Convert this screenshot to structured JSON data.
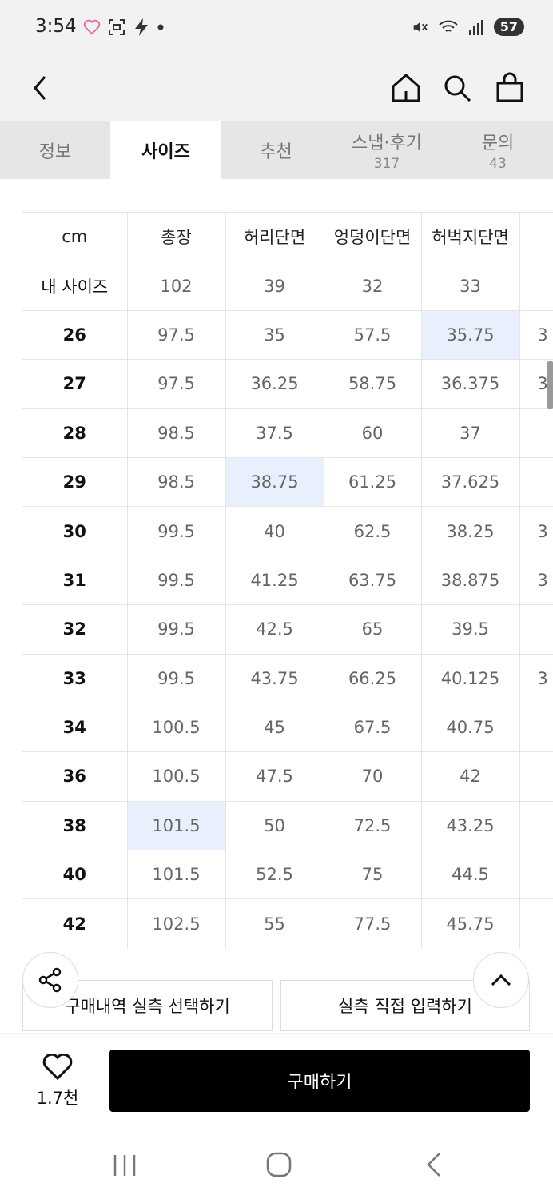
{
  "status": {
    "time": "3:54",
    "battery": "57",
    "left_icons": [
      "heart-icon",
      "screen-capture-icon",
      "charging-bolt-icon",
      "dot-icon"
    ],
    "right_icons": [
      "mute-icon",
      "wifi-icon",
      "signal-icon",
      "battery-icon"
    ]
  },
  "nav": {
    "icons": [
      "back-icon",
      "home-icon",
      "search-icon",
      "shopping-bag-icon"
    ]
  },
  "tabs": [
    {
      "label": "정보",
      "count": "",
      "active": false
    },
    {
      "label": "사이즈",
      "count": "",
      "active": true
    },
    {
      "label": "추천",
      "count": "",
      "active": false
    },
    {
      "label": "스냅·후기",
      "count": "317",
      "active": false
    },
    {
      "label": "문의",
      "count": "43",
      "active": false
    }
  ],
  "size_table": {
    "headers": [
      "cm",
      "총장",
      "허리단면",
      "엉덩이단면",
      "허벅지단면"
    ],
    "my_size": [
      "내 사이즈",
      "102",
      "39",
      "32",
      "33"
    ],
    "rows": [
      [
        "26",
        "97.5",
        "35",
        "57.5",
        "35.75",
        "3"
      ],
      [
        "27",
        "97.5",
        "36.25",
        "58.75",
        "36.375",
        "3"
      ],
      [
        "28",
        "98.5",
        "37.5",
        "60",
        "37",
        ""
      ],
      [
        "29",
        "98.5",
        "38.75",
        "61.25",
        "37.625",
        ""
      ],
      [
        "30",
        "99.5",
        "40",
        "62.5",
        "38.25",
        "3"
      ],
      [
        "31",
        "99.5",
        "41.25",
        "63.75",
        "38.875",
        "3"
      ],
      [
        "32",
        "99.5",
        "42.5",
        "65",
        "39.5",
        ""
      ],
      [
        "33",
        "99.5",
        "43.75",
        "66.25",
        "40.125",
        "3"
      ],
      [
        "34",
        "100.5",
        "45",
        "67.5",
        "40.75",
        ""
      ],
      [
        "36",
        "100.5",
        "47.5",
        "70",
        "42",
        ""
      ],
      [
        "38",
        "101.5",
        "50",
        "72.5",
        "43.25",
        ""
      ],
      [
        "40",
        "101.5",
        "52.5",
        "75",
        "44.5",
        ""
      ],
      [
        "42",
        "102.5",
        "55",
        "77.5",
        "45.75",
        ""
      ]
    ],
    "highlighted_cells": [
      {
        "size": "26",
        "column": "허벅지단면"
      },
      {
        "size": "29",
        "column": "허리단면"
      },
      {
        "size": "38",
        "column": "총장"
      }
    ],
    "highlight_color": "#e8effd"
  },
  "actions": {
    "select_history": "구매내역 실측 선택하기",
    "direct_input": "실측 직접 입력하기"
  },
  "bottom": {
    "like_count": "1.7천",
    "buy_label": "구매하기"
  },
  "colors": {
    "buy_button": "#000000",
    "tab_bar": "#e6e6e6",
    "header_bg": "#f2f2f2"
  }
}
